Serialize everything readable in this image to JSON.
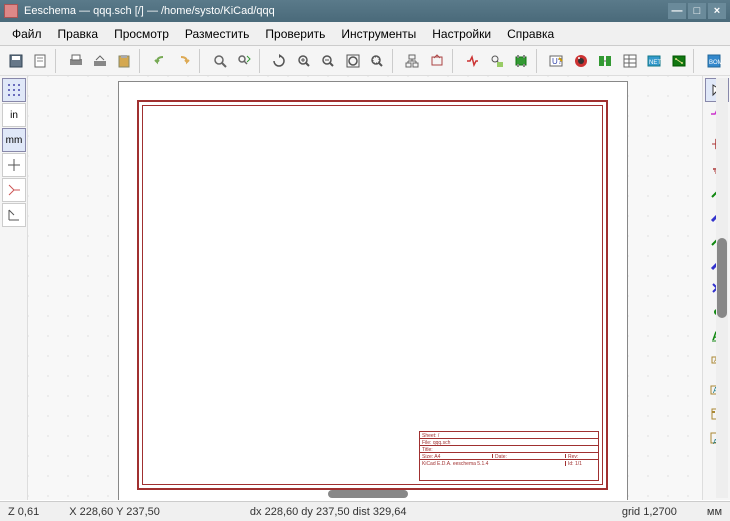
{
  "titlebar": {
    "app": "Eeschema",
    "file": "qqq.sch [/]",
    "sep": "—",
    "path": "/home/systo/KiCad/qqq"
  },
  "window": {
    "min": "—",
    "max": "□",
    "close": "×"
  },
  "menu": {
    "file": "Файл",
    "edit": "Правка",
    "view": "Просмотр",
    "place": "Разместить",
    "inspect": "Проверить",
    "tools": "Инструменты",
    "preferences": "Настройки",
    "help": "Справка"
  },
  "left_toolbar": {
    "grid": "grid",
    "in": "in",
    "mm": "mm",
    "cursor": "cursor",
    "hidden_pins": "hidden-pins",
    "origin": "origin"
  },
  "statusbar": {
    "zoom": "Z 0,61",
    "xy": "X 228,60  Y 237,50",
    "dxdy": "dx 228,60   dy 237,50   dist 329,64",
    "grid": "grid 1,2700",
    "unit": "мм"
  },
  "titleblock": {
    "r0": "Sheet:  /",
    "r1": "File: qqq.sch",
    "r2": "Title:",
    "r3l": "Size: A4",
    "r3c": "Date:",
    "r3r": "Rev:",
    "r4l": "KiCad E.D.A.  eeschema  5.1.4",
    "r4r": "Id: 1/1"
  }
}
